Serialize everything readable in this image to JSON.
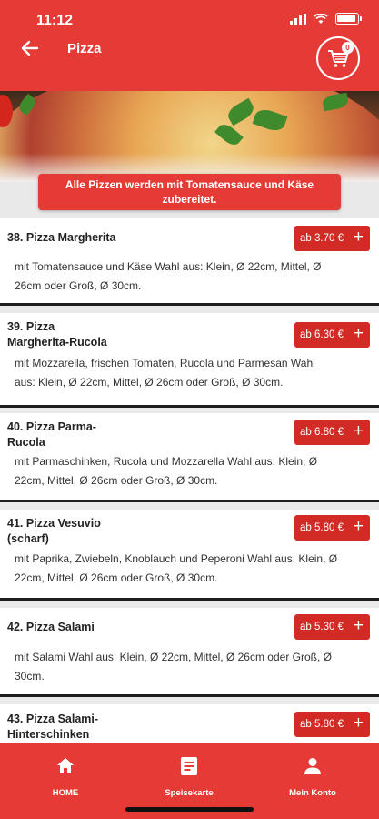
{
  "status_bar": {
    "time": "11:12"
  },
  "header": {
    "title": "Pizza",
    "cart_count": "0"
  },
  "banner": {
    "text_line1": "Alle Pizzen werden mit Tomatensauce und Käse",
    "text_line2": "zubereitet."
  },
  "items": [
    {
      "name_line1": "38. Pizza Margherita",
      "name_line2": "",
      "price": "ab 3.70 €",
      "desc_line1": "mit Tomatensauce und Käse Wahl aus: Klein, Ø 22cm, Mittel, Ø",
      "desc_line2": "26cm oder Groß, Ø 30cm."
    },
    {
      "name_line1": "39. Pizza",
      "name_line2": "Margherita-Rucola",
      "price": "ab 6.30 €",
      "desc_line1": "mit Mozzarella, frischen Tomaten, Rucola und Parmesan Wahl",
      "desc_line2": "aus: Klein, Ø 22cm, Mittel, Ø 26cm oder Groß, Ø 30cm."
    },
    {
      "name_line1": "40. Pizza Parma-",
      "name_line2": "Rucola",
      "price": "ab 6.80 €",
      "desc_line1": "mit Parmaschinken, Rucola und Mozzarella Wahl aus: Klein, Ø",
      "desc_line2": "22cm, Mittel, Ø 26cm oder Groß, Ø 30cm."
    },
    {
      "name_line1": "41. Pizza Vesuvio",
      "name_line2": "(scharf)",
      "price": "ab 5.80 €",
      "desc_line1": "mit Paprika, Zwiebeln, Knoblauch und Peperoni Wahl aus: Klein, Ø",
      "desc_line2": "22cm, Mittel, Ø 26cm oder Groß, Ø 30cm."
    },
    {
      "name_line1": "42. Pizza Salami",
      "name_line2": "",
      "price": "ab 5.30 €",
      "desc_line1": "mit Salami Wahl aus: Klein, Ø 22cm, Mittel, Ø 26cm oder Groß, Ø",
      "desc_line2": "30cm."
    },
    {
      "name_line1": "43. Pizza Salami-",
      "name_line2": "Hinterschinken",
      "price": "ab 5.80 €",
      "desc_line1": "",
      "desc_line2": ""
    }
  ],
  "add_symbol": "+",
  "bottom_nav": {
    "home": "HOME",
    "menu": "Speisekarte",
    "account": "Mein Konto"
  },
  "colors": {
    "brand_red": "#e53a36",
    "button_red": "#d22a24"
  },
  "icons": {
    "back": "arrow-left-icon",
    "cart": "cart-icon",
    "home": "home-icon",
    "menu": "menu-card-icon",
    "account": "person-icon"
  }
}
